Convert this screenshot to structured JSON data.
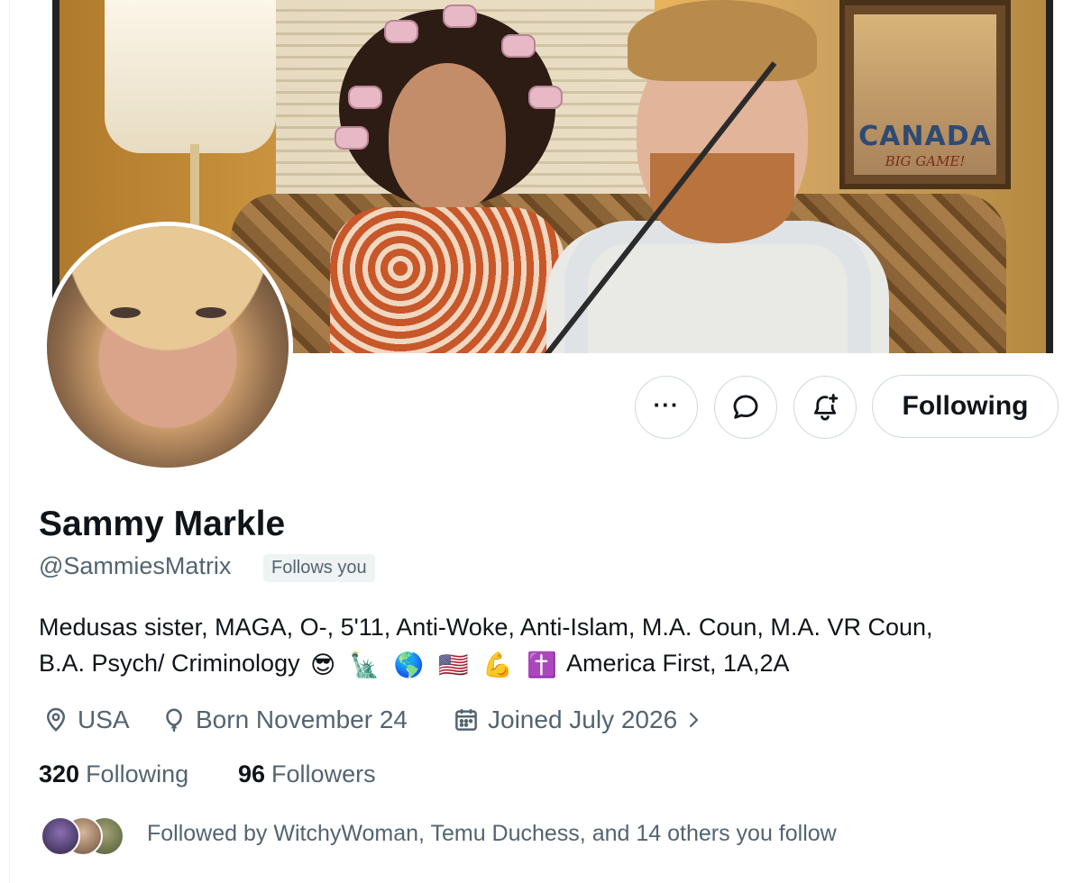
{
  "banner": {
    "poster_title": "CANADA",
    "poster_subtitle": "BIG GAME!"
  },
  "actions": {
    "more_label": "···",
    "following_label": "Following"
  },
  "profile": {
    "display_name": "Sammy Markle",
    "handle": "@SammiesMatrix",
    "follows_you": "Follows you",
    "bio_line1": "Medusas sister, MAGA, O-, 5'11, Anti-Woke, Anti-Islam, M.A. Coun, M.A. VR Coun,",
    "bio_line2_text": "B.A. Psych/ Criminology",
    "bio_emojis": [
      "😎",
      "🗽",
      "🌎",
      "🇺🇸",
      "💪",
      "✝️"
    ],
    "bio_line2_tail": "America First, 1A,2A",
    "location": "USA",
    "birthday": "Born November 24",
    "joined": "Joined July 2026"
  },
  "stats": {
    "following_count": "320",
    "following_label": "Following",
    "followers_count": "96",
    "followers_label": "Followers"
  },
  "followed_by": {
    "text": "Followed by WitchyWoman, Temu Duchess, and 14 others you follow"
  },
  "colors": {
    "primary_text": "#0f1419",
    "secondary_text": "#536471",
    "border": "#cfd9de",
    "badge_bg": "#eff3f4"
  },
  "icons": [
    "more-icon",
    "message-icon",
    "notification-bell-icon",
    "location-icon",
    "balloon-icon",
    "calendar-icon",
    "chevron-right-icon"
  ]
}
